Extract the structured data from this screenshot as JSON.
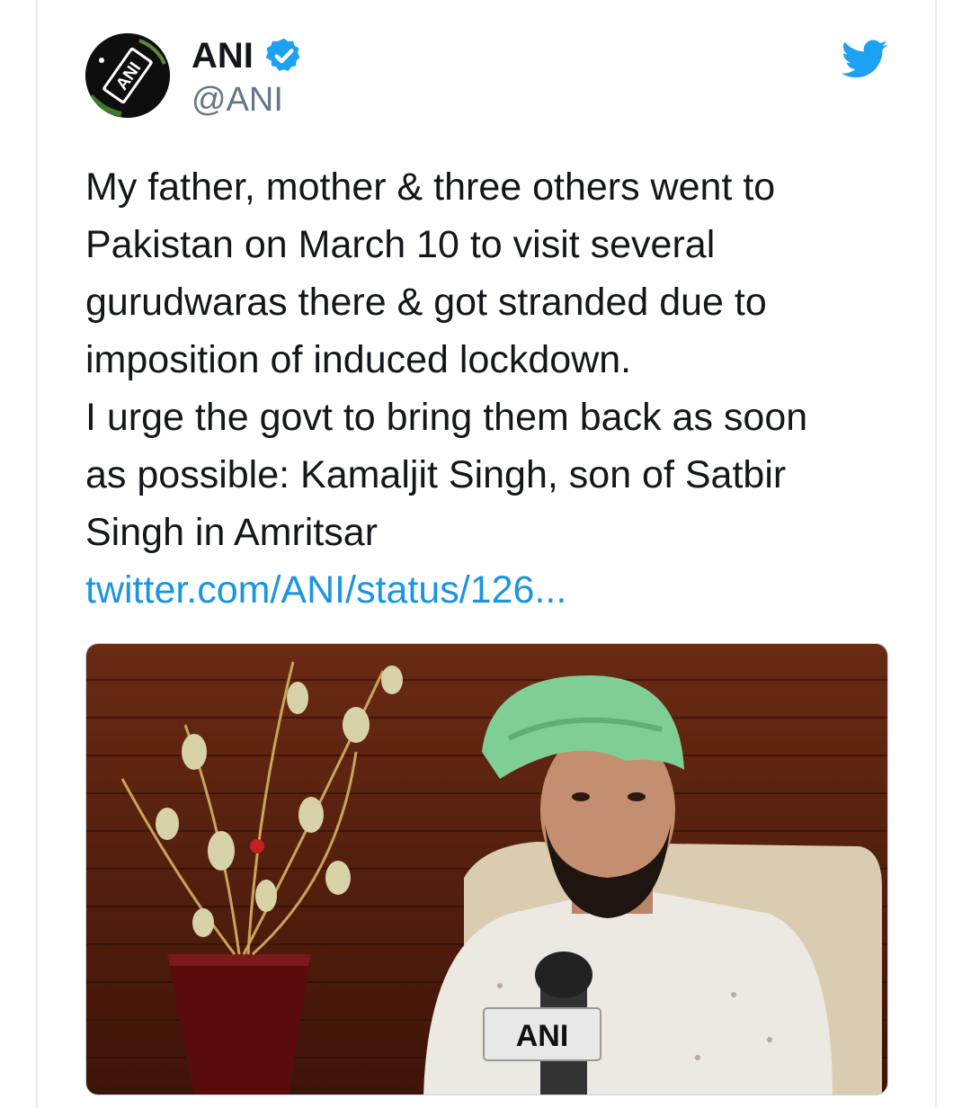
{
  "tweet": {
    "author": {
      "display_name": "ANI",
      "handle": "@ANI",
      "avatar_text": "ANI",
      "verified": true
    },
    "text": "My father, mother & three others went to\nPakistan on March 10 to visit several\ngurudwaras there & got stranded due to\nimposition of          induced lockdown.\nI urge the govt to bring them back as soon\nas possible: Kamaljit Singh, son of Satbir\nSingh in Amritsar",
    "link": "twitter.com/ANI/status/126...",
    "media": {
      "mic_label": "ANI"
    }
  },
  "icons": {
    "platform": "twitter-bird-icon",
    "verified": "verified-badge-icon"
  },
  "colors": {
    "link": "#1b95e0",
    "verified": "#1da1f2",
    "twitter": "#1da1f2",
    "text": "#14171a",
    "muted": "#657786"
  }
}
